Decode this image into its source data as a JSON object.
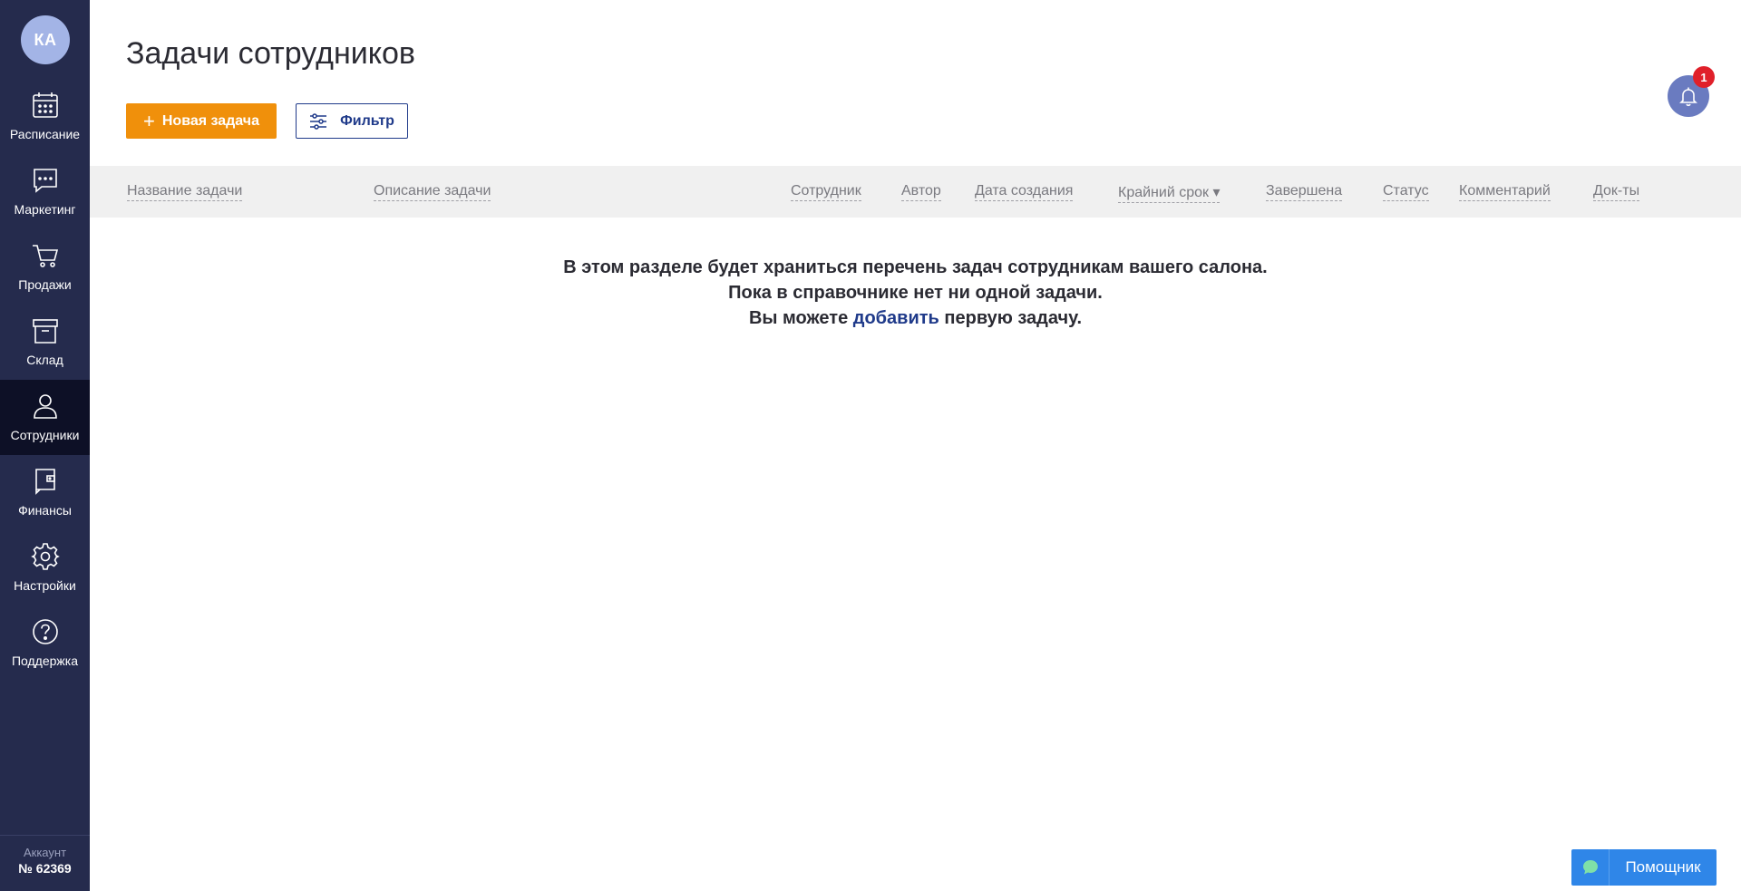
{
  "sidebar": {
    "avatar": "КА",
    "items": [
      {
        "label": "Расписание",
        "icon": "calendar-icon",
        "active": false
      },
      {
        "label": "Маркетинг",
        "icon": "chat-icon",
        "active": false
      },
      {
        "label": "Продажи",
        "icon": "cart-icon",
        "active": false
      },
      {
        "label": "Склад",
        "icon": "box-icon",
        "active": false
      },
      {
        "label": "Сотрудники",
        "icon": "user-icon",
        "active": true
      },
      {
        "label": "Финансы",
        "icon": "wallet-icon",
        "active": false
      },
      {
        "label": "Настройки",
        "icon": "gear-icon",
        "active": false
      },
      {
        "label": "Поддержка",
        "icon": "help-icon",
        "active": false
      }
    ],
    "account": {
      "label": "Аккаунт",
      "number": "№ 62369"
    }
  },
  "header": {
    "title": "Задачи сотрудников",
    "new_task_label": "Новая задача",
    "filter_label": "Фильтр",
    "notifications_count": "1"
  },
  "table": {
    "columns": [
      "Название задачи",
      "Описание задачи",
      "Сотрудник",
      "Автор",
      "Дата создания",
      "Крайний срок ▾",
      "Завершена",
      "Статус",
      "Комментарий",
      "Док-ты"
    ]
  },
  "empty_state": {
    "line1": "В этом разделе будет храниться перечень задач сотрудникам вашего салона.",
    "line2": "Пока в справочнике нет ни одной задачи.",
    "line3_before": "Вы можете",
    "line3_link": "добавить",
    "line3_after": "первую задачу."
  },
  "helper": {
    "label": "Помощник"
  },
  "colors": {
    "sidebar": "#252b4d",
    "sidebar_active": "#0d1026",
    "accent_orange": "#f0900b",
    "link_blue": "#1f3a8a",
    "helper_blue": "#2f86e8",
    "badge_red": "#e0202a"
  }
}
